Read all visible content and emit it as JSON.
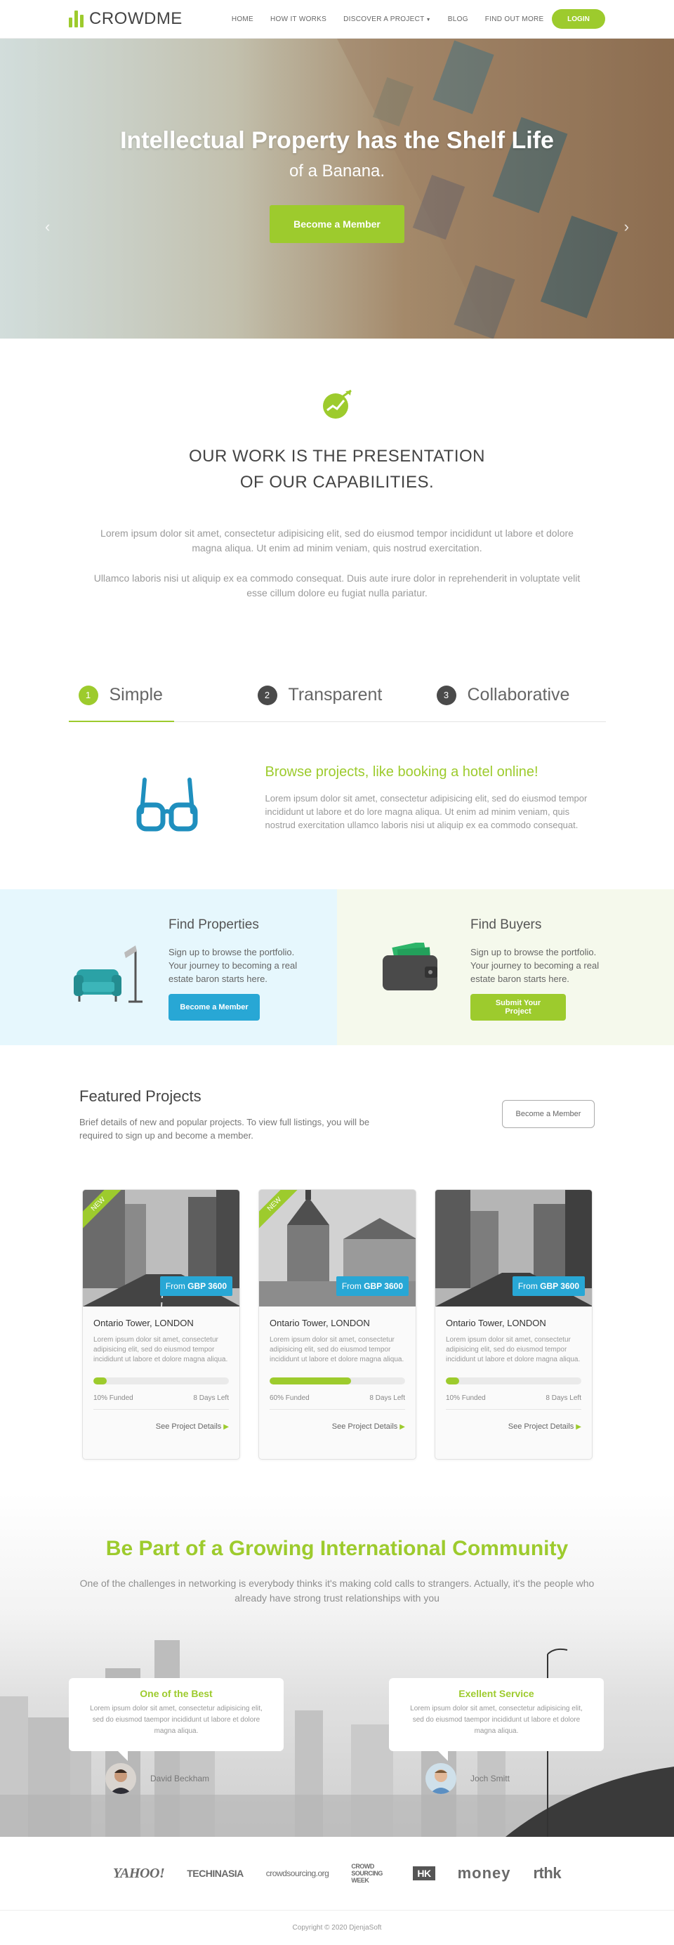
{
  "nav": {
    "brand": "CROWDME",
    "links": [
      "HOME",
      "HOW IT WORKS",
      "DISCOVER A PROJECT",
      "BLOG",
      "FIND OUT MORE"
    ],
    "login": "LOGIN"
  },
  "hero": {
    "title": "Intellectual Property has the Shelf Life",
    "subtitle": "of a Banana.",
    "cta": "Become a Member",
    "prev": "‹",
    "next": "›"
  },
  "work": {
    "title_line1": "OUR WORK IS THE PRESENTATION",
    "title_line2": "OF OUR CAPABILITIES.",
    "p1": "Lorem ipsum dolor sit amet, consectetur adipisicing elit, sed do eiusmod tempor incididunt ut labore et dolore magna aliqua. Ut enim ad minim veniam, quis nostrud exercitation.",
    "p2": "Ullamco laboris nisi ut aliquip ex ea commodo consequat. Duis aute irure dolor in reprehenderit in voluptate velit esse cillum dolore eu fugiat nulla pariatur."
  },
  "tabs": [
    {
      "num": "1",
      "label": "Simple"
    },
    {
      "num": "2",
      "label": "Transparent"
    },
    {
      "num": "3",
      "label": "Collaborative"
    }
  ],
  "tab_panel": {
    "title": "Browse projects, like booking a hotel online!",
    "text": "Lorem ipsum dolor sit amet, consectetur adipisicing elit, sed do eiusmod tempor incididunt ut labore et do lore magna aliqua. Ut enim ad minim veniam, quis nostrud exercitation ullamco laboris nisi ut aliquip ex ea commodo consequat."
  },
  "find": {
    "properties": {
      "title": "Find Properties",
      "text": "Sign up to browse the portfolio. Your journey to becoming a real estate baron starts here.",
      "button": "Become a Member"
    },
    "buyers": {
      "title": "Find Buyers",
      "text": "Sign up to browse the portfolio. Your journey to becoming a real estate baron starts here.",
      "button": "Submit Your Project"
    }
  },
  "featured": {
    "title": "Featured Projects",
    "desc": "Brief details of new and popular projects. To view full listings, you will be required to sign up and become a member.",
    "button": "Become a Member",
    "cards": [
      {
        "badge": "NEW",
        "price_prefix": "From",
        "price": "GBP 3600",
        "title": "Ontario Tower, LONDON",
        "text": "Lorem ipsum dolor sit amet, consectetur adipisicing elit, sed do eiusmod tempor incididunt ut labore et dolore magna aliqua.",
        "funded_pct": 0.1,
        "funded": "10% Funded",
        "days": "8 Days Left",
        "link": "See Project Details"
      },
      {
        "badge": "NEW",
        "price_prefix": "From",
        "price": "GBP 3600",
        "title": "Ontario Tower, LONDON",
        "text": "Lorem ipsum dolor sit amet, consectetur adipisicing elit, sed do eiusmod tempor incididunt ut labore et dolore magna aliqua.",
        "funded_pct": 0.6,
        "funded": "60% Funded",
        "days": "8 Days Left",
        "link": "See Project Details"
      },
      {
        "badge": "",
        "price_prefix": "From",
        "price": "GBP 3600",
        "title": "Ontario Tower, LONDON",
        "text": "Lorem ipsum dolor sit amet, consectetur adipisicing elit, sed do eiusmod tempor incididunt ut labore et dolore magna aliqua.",
        "funded_pct": 0.1,
        "funded": "10% Funded",
        "days": "8 Days Left",
        "link": "See Project Details"
      }
    ]
  },
  "community": {
    "title": "Be Part of a Growing International Community",
    "subtitle": "One of the challenges in networking is everybody thinks it's making cold calls to strangers. Actually, it's the people who already have strong trust relationships with you",
    "testimonials": [
      {
        "title": "One of the Best",
        "text": "Lorem ipsum dolor sit amet, consectetur adipisicing elit, sed do eiusmod taempor incididunt ut labore et dolore magna aliqua.",
        "name": "David Beckham"
      },
      {
        "title": "Exellent Service",
        "text": "Lorem ipsum dolor sit amet, consectetur adipisicing elit, sed do eiusmod taempor incididunt ut labore et dolore magna aliqua.",
        "name": "Joch Smitt"
      }
    ]
  },
  "partners": [
    "YAHOO!",
    "TECHINASIA",
    "crowdsourcing.org",
    "CROWD SOURCING WEEK",
    "HK",
    "money",
    "rthk"
  ],
  "footer": {
    "copyright": "Copyright © 2020 DjenjaSoft"
  },
  "colors": {
    "accent": "#9dcb2d",
    "blue": "#28a7d5"
  }
}
